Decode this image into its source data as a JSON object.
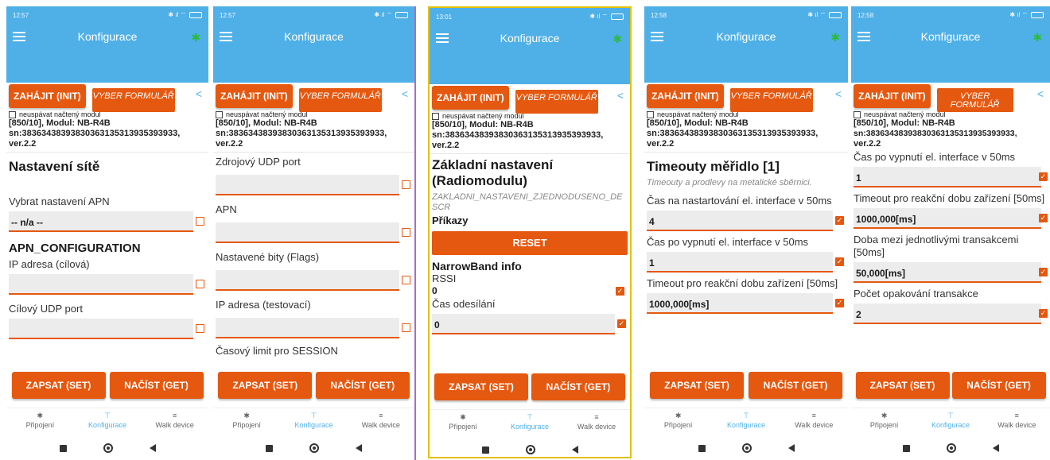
{
  "common": {
    "app_title": "Konfigurace",
    "init_label": "ZAHÁJIT (INIT)",
    "form_label": "VYBER FORMULÁŘ",
    "checkbox_label": "neuspávat načtený modul",
    "module_line": "[850/10], Modul: NB-R4B",
    "sn_line": "sn:38363438393830363135313935393​3,",
    "sn_text": "sn:38363438393830363135313935393933,",
    "ver_line": "ver.2.2",
    "set_label": "ZAPSAT (SET)",
    "get_label": "NAČÍST (GET)",
    "tabs": [
      "Připojení",
      "Konfigurace",
      "Walk device"
    ],
    "accent": "#e5580f",
    "header_color": "#4fb0e8"
  },
  "phones": [
    {
      "time": "12:57",
      "heading": "Nastavení sítě",
      "fields": [
        {
          "label": "Vybrat nastavení APN",
          "value": "-- n/a --"
        },
        {
          "section": "APN_CONFIGURATION"
        },
        {
          "label": "IP adresa (cílová)",
          "value": ""
        },
        {
          "label": "Cílový UDP port",
          "value": ""
        }
      ]
    },
    {
      "time": "12:57",
      "fields": [
        {
          "label": "Zdrojový UDP port",
          "value": ""
        },
        {
          "label": "APN",
          "value": ""
        },
        {
          "label": "Nastavené bity (Flags)",
          "value": ""
        },
        {
          "label": "IP adresa (testovací)",
          "value": ""
        },
        {
          "label": "Časový limit pro SESSION"
        }
      ]
    },
    {
      "time": "13:01",
      "heading": "Základní nastavení (Radiomodulu)",
      "description": "ZAKLADNI_NASTAVENI_ZJEDNODUSENO_DESCR",
      "commands_label": "Příkazy",
      "reset_label": "RESET",
      "section": "NarrowBand info",
      "rssi_label": "RSSI",
      "rssi_value": "0",
      "send_time_label": "Čas odesílání",
      "send_time_value": "0"
    },
    {
      "time": "12:58",
      "heading": "Timeouty měřidlo [1]",
      "description": "Timeouty a prodlevy na metalické sběrnici.",
      "fields": [
        {
          "label": "Čas na nastartování el. interface v 50ms",
          "value": "4"
        },
        {
          "label": "Čas po vypnutí el. interface v 50ms",
          "value": "1"
        },
        {
          "label": "Timeout pro reakční dobu zařízení [50ms]",
          "value": "1000,000[ms]"
        }
      ]
    },
    {
      "time": "12:58",
      "fields": [
        {
          "label": "Čas po vypnutí el. interface v 50ms",
          "value": "1"
        },
        {
          "label": "Timeout pro reakční dobu zařízení [50ms]",
          "value": "1000,000[ms]"
        },
        {
          "label": "Doba mezi jednotlivými transakcemi [50ms]",
          "value": "50,000[ms]"
        },
        {
          "label": "Počet opakování transakce",
          "value": "2"
        }
      ]
    }
  ]
}
